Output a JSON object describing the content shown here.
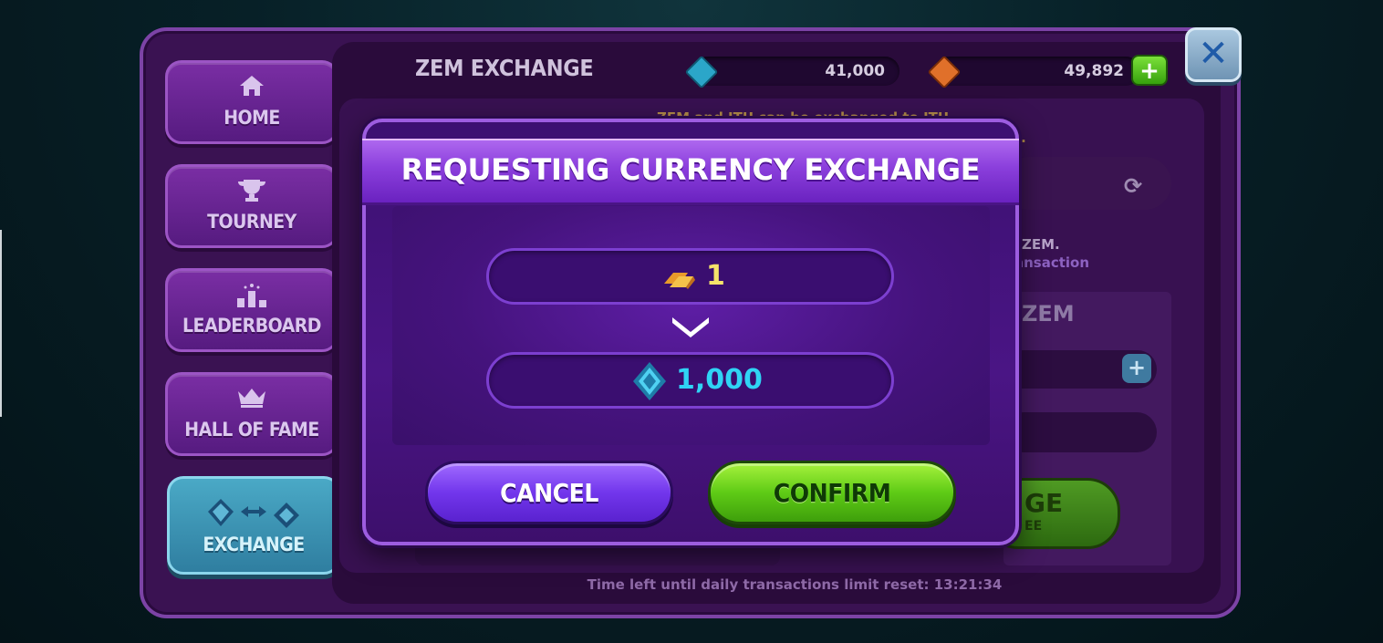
{
  "window": {
    "title": "ZEM EXCHANGE",
    "close_label": "✕"
  },
  "balances": {
    "zem": "41,000",
    "itu": "49,892",
    "add_label": "+"
  },
  "sidebar": {
    "items": [
      {
        "label": "HOME",
        "icon": "home-icon"
      },
      {
        "label": "TOURNEY",
        "icon": "trophy-icon"
      },
      {
        "label": "LEADERBOARD",
        "icon": "leaderboard-icon"
      },
      {
        "label": "HALL OF FAME",
        "icon": "crown-icon"
      },
      {
        "label": "EXCHANGE",
        "icon": "exchange-icon",
        "active": true
      }
    ]
  },
  "background_panel": {
    "info_line1": "ZEM and ITU can be exchanged to ITU",
    "info_fragment_t": "t.",
    "zem_fragment": "ZEM.",
    "transaction_fragment": "ansaction",
    "section_title_fragment": "ZEM",
    "exchange_button_fragment": "GE",
    "exchange_button_sub_fragment": "EE",
    "timer": "Time left until daily transactions limit reset: 13:21:34"
  },
  "modal": {
    "title": "REQUESTING CURRENCY EXCHANGE",
    "from_amount": "1",
    "from_icon": "gold-bar-icon",
    "to_amount": "1,000",
    "to_icon": "zem-diamond-icon",
    "cancel_label": "CANCEL",
    "confirm_label": "CONFIRM"
  },
  "colors": {
    "modal_header": "#8b3fdc",
    "confirm": "#5fcb16",
    "cancel": "#7236ec",
    "zem_value": "#2fd4f5",
    "itu_value": "#f5e36a"
  }
}
